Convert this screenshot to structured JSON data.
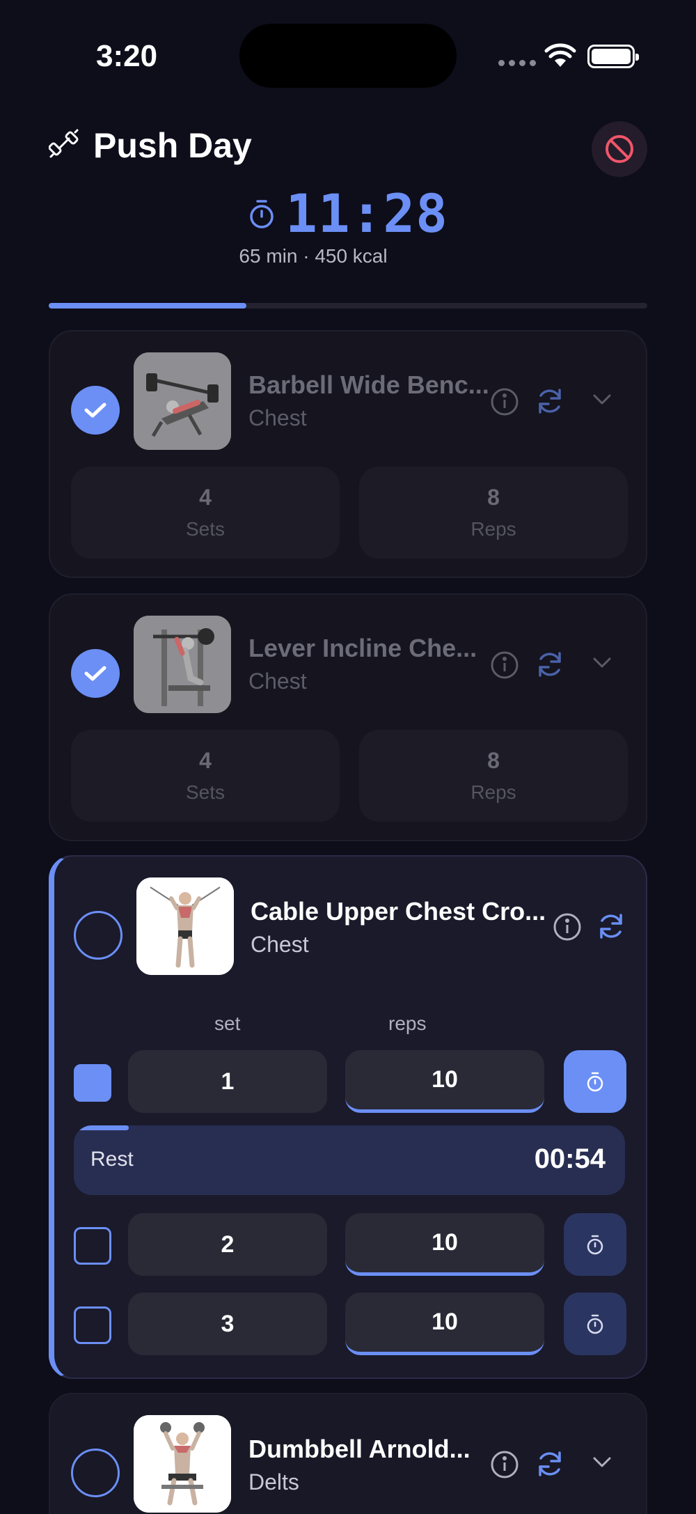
{
  "status_bar": {
    "time": "3:20"
  },
  "header": {
    "title": "Push Day",
    "timer": "11:28",
    "subtitle": "65 min · 450 kcal",
    "workout_progress": 0.33
  },
  "exercises": [
    {
      "name": "Barbell Wide Benc...",
      "muscle": "Chest",
      "completed": true,
      "sets": {
        "value": "4",
        "label": "Sets"
      },
      "reps": {
        "value": "8",
        "label": "Reps"
      }
    },
    {
      "name": "Lever Incline Che...",
      "muscle": "Chest",
      "completed": true,
      "sets": {
        "value": "4",
        "label": "Sets"
      },
      "reps": {
        "value": "8",
        "label": "Reps"
      }
    },
    {
      "name": "Cable Upper Chest Cro...",
      "muscle": "Chest",
      "completed": false,
      "columns": {
        "set": "set",
        "reps": "reps"
      },
      "set_rows": [
        {
          "set": "1",
          "reps": "10",
          "done": true
        },
        {
          "set": "2",
          "reps": "10",
          "done": false
        },
        {
          "set": "3",
          "reps": "10",
          "done": false
        }
      ],
      "rest": {
        "label": "Rest",
        "time": "00:54",
        "progress": 0.1
      }
    },
    {
      "name": "Dumbbell Arnold...",
      "muscle": "Delts",
      "completed": false
    }
  ],
  "colors": {
    "accent": "#6b8ff5",
    "background": "#0e0d1a",
    "danger": "#f0566a"
  }
}
